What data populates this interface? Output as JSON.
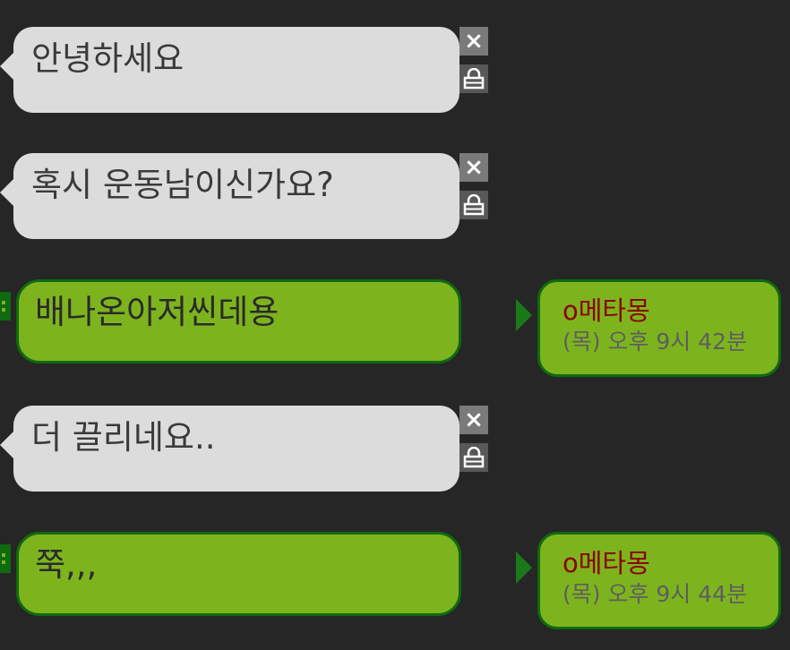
{
  "messages": [
    {
      "side": "received",
      "text": "안녕하세요"
    },
    {
      "side": "received",
      "text": "혹시 운동남이신가요?"
    },
    {
      "side": "sent",
      "text": "배나온아저씬데용",
      "username": "o메타몽",
      "timestamp": "(목) 오후 9시 42분"
    },
    {
      "side": "received",
      "text": "더 끌리네요.."
    },
    {
      "side": "sent",
      "text": "쭉,,,",
      "username": "o메타몽",
      "timestamp": "(목) 오후 9시 44분"
    }
  ],
  "icons": {
    "close": "×",
    "lock": "lock-icon",
    "drag": "drag-handle-icon",
    "tail": "triangle-right-icon"
  },
  "colors": {
    "background": "#262626",
    "received_bubble": "#dcdcdc",
    "sent_bubble": "#7db41e",
    "sent_border": "#0f6a10",
    "username": "#8b0000"
  }
}
